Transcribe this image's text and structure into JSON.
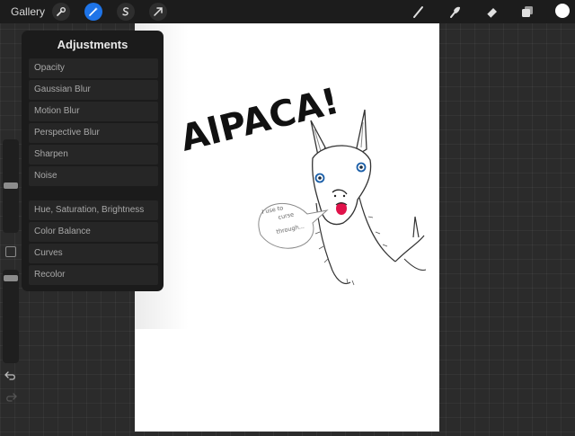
{
  "topbar": {
    "gallery_label": "Gallery",
    "left_tools": [
      "wrench-icon",
      "magic-wand-icon",
      "selection-icon",
      "transform-arrow-icon"
    ],
    "right_tools": [
      "brush-icon",
      "smudge-icon",
      "eraser-icon",
      "layers-icon"
    ],
    "active_tool": "magic-wand-icon",
    "accent_color": "#1e74e8",
    "current_color": "#ffffff"
  },
  "adjustments": {
    "title": "Adjustments",
    "group1": [
      "Opacity",
      "Gaussian Blur",
      "Motion Blur",
      "Perspective Blur",
      "Sharpen",
      "Noise"
    ],
    "group2": [
      "Hue, Saturation, Brightness",
      "Color Balance",
      "Curves",
      "Recolor"
    ]
  },
  "canvas": {
    "title_text": "AlPACA!",
    "speech_text": [
      "I use to",
      "curse",
      "through..."
    ]
  },
  "sidebar": {
    "undo_icon": "undo-icon",
    "redo_icon": "redo-icon"
  }
}
